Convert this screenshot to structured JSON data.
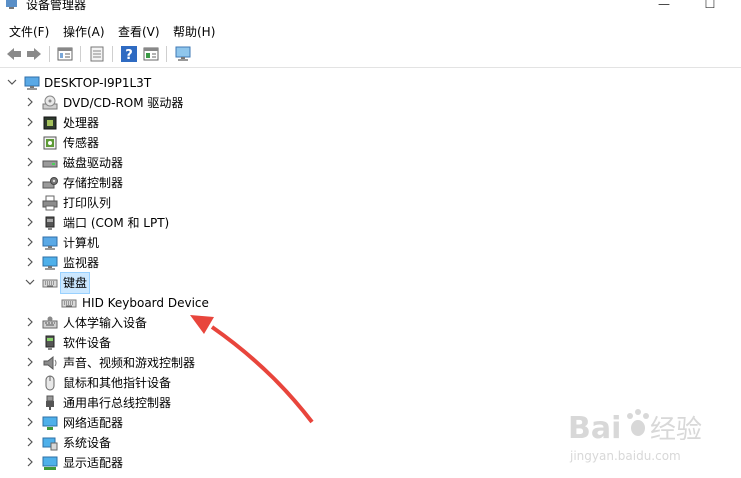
{
  "window": {
    "title": "设备管理器",
    "controls": {
      "minimize": "—",
      "maximize": "☐",
      "close": "✕"
    }
  },
  "menu": [
    {
      "label": "文件(F)"
    },
    {
      "label": "操作(A)"
    },
    {
      "label": "查看(V)"
    },
    {
      "label": "帮助(H)"
    }
  ],
  "toolbar": {
    "icons": [
      "back-icon",
      "forward-icon",
      "properties-icon",
      "update-driver-icon",
      "help-icon",
      "view-icon",
      "monitor-scan-icon"
    ]
  },
  "tree": {
    "root": {
      "label": "DESKTOP-I9P1L3T",
      "icon": "computer-icon",
      "expanded": true
    },
    "items": [
      {
        "label": "DVD/CD-ROM 驱动器",
        "icon": "dvd-icon",
        "expanded": false
      },
      {
        "label": "处理器",
        "icon": "processor-icon",
        "expanded": false
      },
      {
        "label": "传感器",
        "icon": "sensor-icon",
        "expanded": false
      },
      {
        "label": "磁盘驱动器",
        "icon": "disk-icon",
        "expanded": false
      },
      {
        "label": "存储控制器",
        "icon": "storage-controller-icon",
        "expanded": false
      },
      {
        "label": "打印队列",
        "icon": "printer-icon",
        "expanded": false
      },
      {
        "label": "端口 (COM 和 LPT)",
        "icon": "port-icon",
        "expanded": false
      },
      {
        "label": "计算机",
        "icon": "computer-icon",
        "expanded": false
      },
      {
        "label": "监视器",
        "icon": "monitor-icon",
        "expanded": false
      },
      {
        "label": "键盘",
        "icon": "keyboard-icon",
        "expanded": true,
        "selected": true,
        "children": [
          {
            "label": "HID Keyboard Device",
            "icon": "keyboard-icon"
          }
        ]
      },
      {
        "label": "人体学输入设备",
        "icon": "hid-icon",
        "expanded": false
      },
      {
        "label": "软件设备",
        "icon": "software-device-icon",
        "expanded": false
      },
      {
        "label": "声音、视频和游戏控制器",
        "icon": "speaker-icon",
        "expanded": false
      },
      {
        "label": "鼠标和其他指针设备",
        "icon": "mouse-icon",
        "expanded": false
      },
      {
        "label": "通用串行总线控制器",
        "icon": "usb-icon",
        "expanded": false
      },
      {
        "label": "网络适配器",
        "icon": "network-icon",
        "expanded": false
      },
      {
        "label": "系统设备",
        "icon": "system-device-icon",
        "expanded": false
      },
      {
        "label": "显示适配器",
        "icon": "display-adapter-icon",
        "expanded": false
      }
    ]
  },
  "annotation": {
    "color": "#e8453c"
  },
  "watermark": {
    "brand": "Bai",
    "brand_suffix": "经验",
    "url": "jingyan.baidu.com"
  },
  "colors": {
    "selection": "#cce8ff",
    "chevron": "#555555"
  }
}
